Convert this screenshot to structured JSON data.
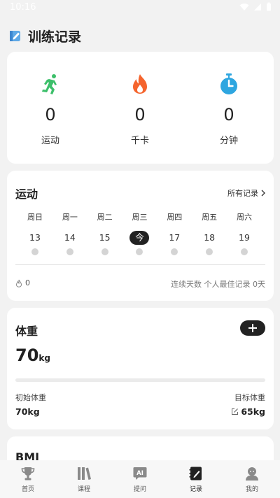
{
  "status_bar": {
    "time": "10:16"
  },
  "header": {
    "title": "训练记录"
  },
  "summary": [
    {
      "value": "0",
      "label": "运动",
      "icon": "running-person-icon"
    },
    {
      "value": "0",
      "label": "千卡",
      "icon": "flame-icon"
    },
    {
      "value": "0",
      "label": "分钟",
      "icon": "stopwatch-icon"
    }
  ],
  "exercise": {
    "title": "运动",
    "all_records": "所有记录",
    "week": [
      {
        "dow": "周日",
        "date": "13"
      },
      {
        "dow": "周一",
        "date": "14"
      },
      {
        "dow": "周二",
        "date": "15"
      },
      {
        "dow": "周三",
        "date": "今",
        "today": true
      },
      {
        "dow": "周四",
        "date": "17"
      },
      {
        "dow": "周五",
        "date": "18"
      },
      {
        "dow": "周六",
        "date": "19"
      }
    ],
    "streak_value": "0",
    "best_record": "连续天数 个人最佳记录 0天"
  },
  "weight": {
    "title": "体重",
    "value": "70",
    "unit": "kg",
    "progress": 0,
    "initial_label": "初始体重",
    "initial_value": "70kg",
    "target_label": "目标体重",
    "target_value": "65kg"
  },
  "bmi": {
    "title": "BMI"
  },
  "nav": [
    {
      "label": "首页",
      "icon": "trophy-icon"
    },
    {
      "label": "课程",
      "icon": "books-icon"
    },
    {
      "label": "提问",
      "icon": "ai-chat-icon"
    },
    {
      "label": "记录",
      "icon": "notebook-icon",
      "active": true
    },
    {
      "label": "我的",
      "icon": "user-icon"
    }
  ],
  "colors": {
    "accent_green": "#3cbf6a",
    "accent_orange": "#f5642d",
    "accent_blue": "#2ea6e0",
    "dark": "#222222"
  }
}
